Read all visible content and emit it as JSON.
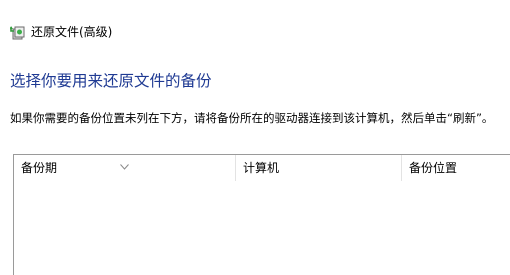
{
  "window": {
    "title": "还原文件(高级)",
    "icon": "restore-files-icon"
  },
  "heading": "选择你要用来还原文件的备份",
  "instructions": "如果你需要的备份位置未列在下方，请将备份所在的驱动器连接到该计算机，然后单击“刷新”。",
  "table": {
    "columns": [
      "备份期",
      "计算机",
      "备份位置"
    ],
    "sort_indicator": "sort-descending-icon",
    "rows": []
  },
  "colors": {
    "heading": "#1f3a93",
    "border": "#9a9a9a"
  }
}
